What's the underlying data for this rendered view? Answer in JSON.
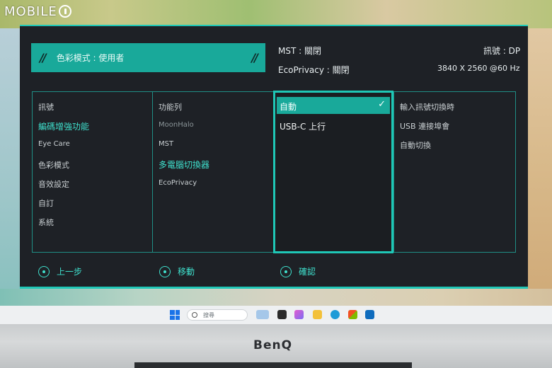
{
  "watermark": {
    "text": "MOBILE"
  },
  "header": {
    "color_mode": "色彩模式 : 使用者",
    "mst": "MST : 關閉",
    "signal": "訊號 : DP",
    "eco_privacy": "EcoPrivacy : 關閉",
    "resolution": "3840 X 2560 @60 Hz"
  },
  "menu": {
    "col1": [
      "訊號",
      "編碼增強功能",
      "Eye Care",
      "色彩模式",
      "音效設定",
      "自訂",
      "系統"
    ],
    "col2": [
      "功能列",
      "MoonHalo",
      "MST",
      "多電腦切換器",
      "EcoPrivacy"
    ],
    "col3_selected": "自動",
    "col3_other": "USB-C 上行",
    "col4": [
      "輸入訊號切換時",
      "USB 連接埠會",
      "自動切換"
    ]
  },
  "nav": {
    "back": "上一步",
    "move": "移動",
    "ok": "確認"
  },
  "taskbar": {
    "search_placeholder": "搜尋"
  },
  "monitor": {
    "brand": "BenQ"
  },
  "colors": {
    "accent": "#1fc7b6",
    "panel": "#1e2126",
    "banner": "#19a99a"
  }
}
